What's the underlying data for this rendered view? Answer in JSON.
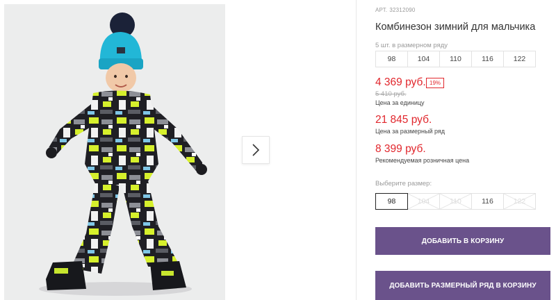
{
  "product": {
    "article_label": "АРТ.",
    "article_number": "32312090",
    "title": "Комбинезон зимний для мальчика",
    "pack_info": "5 шт. в размерном ряду",
    "pack_sizes": [
      "98",
      "104",
      "110",
      "116",
      "122"
    ]
  },
  "pricing": {
    "unit_price": "4 369 руб.",
    "discount": "19%",
    "old_price": "5 410 руб.",
    "unit_caption": "Цена за единицу",
    "pack_price": "21 845 руб.",
    "pack_caption": "Цена за размерный ряд",
    "retail_price": "8 399 руб.",
    "retail_caption": "Рекомендуемая розничная цена"
  },
  "size_select": {
    "label": "Выберите размер:",
    "options": [
      {
        "value": "98",
        "state": "selected"
      },
      {
        "value": "104",
        "state": "disabled"
      },
      {
        "value": "110",
        "state": "disabled"
      },
      {
        "value": "116",
        "state": "available"
      },
      {
        "value": "122",
        "state": "disabled"
      }
    ]
  },
  "actions": {
    "add_to_cart": "ДОБАВИТЬ В КОРЗИНУ",
    "add_pack_to_cart": "ДОБАВИТЬ РАЗМЕРНЫЙ РЯД В КОРЗИНУ"
  },
  "gallery": {
    "next_icon": "chevron-right-icon"
  },
  "colors": {
    "accent_price": "#e1262c",
    "button": "#6a528b",
    "muted": "#999999"
  }
}
